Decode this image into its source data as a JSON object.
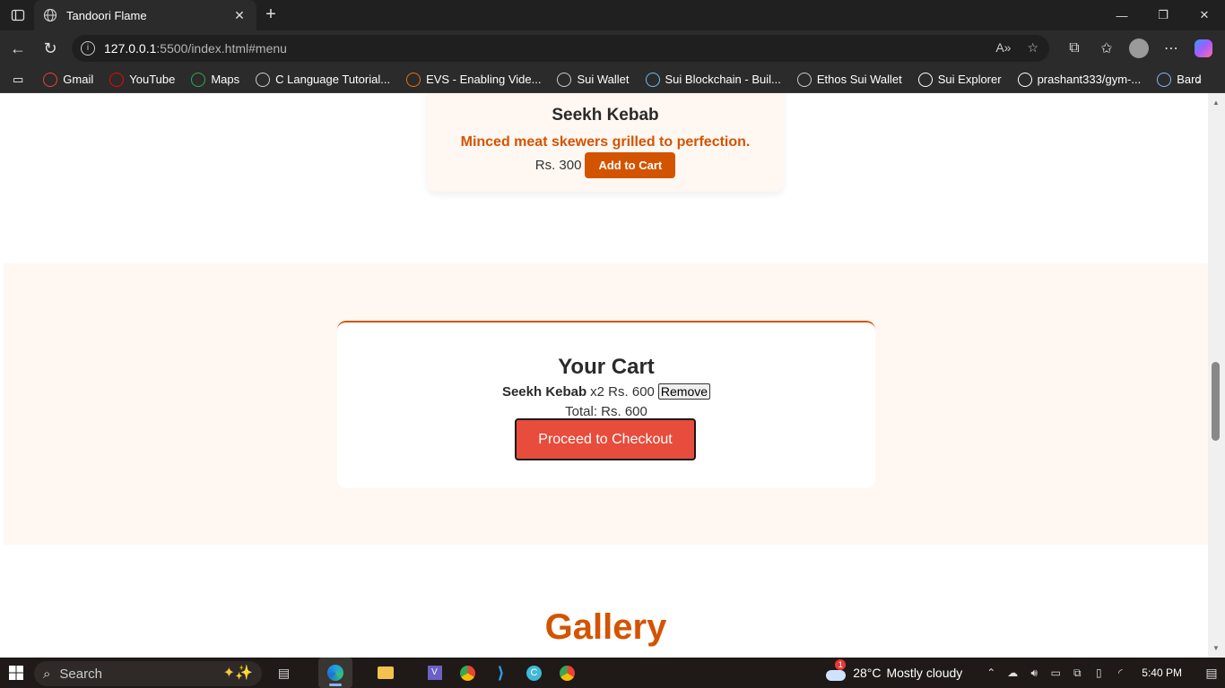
{
  "browser": {
    "tab_title": "Tandoori Flame",
    "url_host": "127.0.0.1",
    "url_rest": ":5500/index.html#menu",
    "bookmarks": [
      {
        "label": "Gmail",
        "icon": "gmail-icon",
        "color": "#ea4335"
      },
      {
        "label": "YouTube",
        "icon": "youtube-icon",
        "color": "#ff0000"
      },
      {
        "label": "Maps",
        "icon": "maps-icon",
        "color": "#34a853"
      },
      {
        "label": "C Language Tutorial...",
        "icon": "globe-icon",
        "color": "#cccccc"
      },
      {
        "label": "EVS - Enabling Vide...",
        "icon": "evs-icon",
        "color": "#e8711a"
      },
      {
        "label": "Sui Wallet",
        "icon": "globe-icon",
        "color": "#cccccc"
      },
      {
        "label": "Sui Blockchain - Buil...",
        "icon": "sui-drop-icon",
        "color": "#6fbcf0"
      },
      {
        "label": "Ethos Sui Wallet",
        "icon": "globe-icon",
        "color": "#cccccc"
      },
      {
        "label": "Sui Explorer",
        "icon": "sui-drop-icon",
        "color": "#ffffff"
      },
      {
        "label": "prashant333/gym-...",
        "icon": "github-icon",
        "color": "#ffffff"
      },
      {
        "label": "Bard",
        "icon": "bard-icon",
        "color": "#8ab4f8"
      }
    ]
  },
  "menu_item": {
    "name": "Seekh Kebab",
    "description": "Minced meat skewers grilled to perfection.",
    "price": "Rs. 300",
    "add_button": "Add to Cart"
  },
  "cart": {
    "title": "Your Cart",
    "item_name": "Seekh Kebab",
    "item_detail": "x2 Rs. 600",
    "remove_button": "Remove",
    "total": "Total: Rs. 600",
    "checkout_button": "Proceed to Checkout"
  },
  "gallery": {
    "title": "Gallery"
  },
  "colors": {
    "accent": "#d35400",
    "checkout": "#e74c3c",
    "section_bg": "#fff7f2"
  },
  "taskbar": {
    "search_placeholder": "Search",
    "weather_temp": "28°C",
    "weather_text": "Mostly cloudy",
    "weather_badge": "1",
    "time": "5:40 PM"
  }
}
